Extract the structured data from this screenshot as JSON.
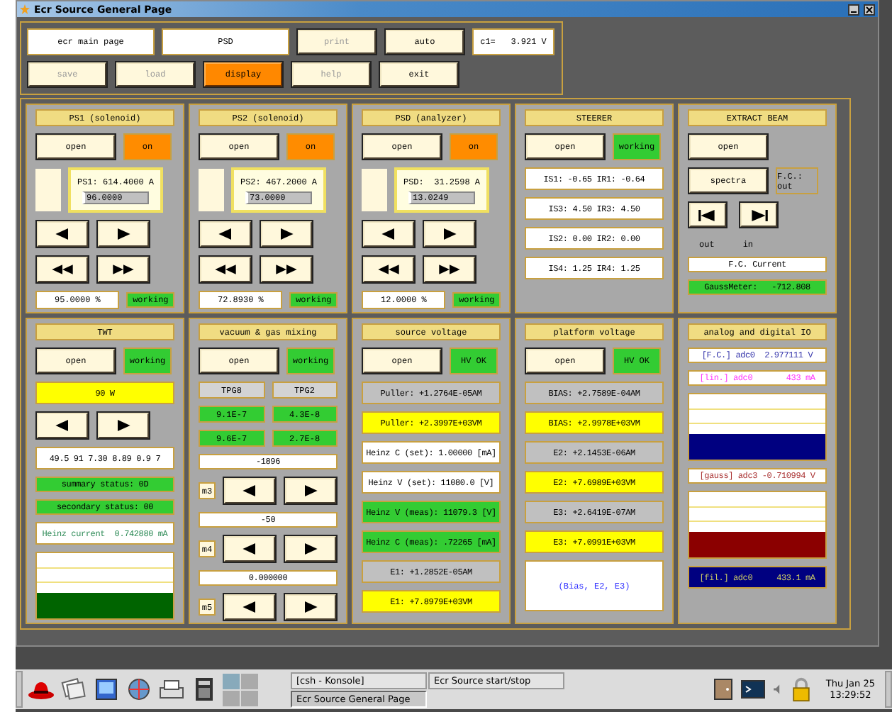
{
  "window": {
    "title": "Ecr Source General Page"
  },
  "toolbar": {
    "row_1": [
      {
        "kind": "label",
        "text": "ecr main page"
      },
      {
        "kind": "label",
        "text": "PSD"
      },
      {
        "kind": "button",
        "text": "print",
        "disabled": true,
        "selected": false
      },
      {
        "kind": "button",
        "text": "auto",
        "disabled": false,
        "selected": false
      },
      {
        "kind": "label",
        "text": "c1=   3.921 V"
      }
    ],
    "row_2": [
      {
        "kind": "button",
        "text": "save",
        "disabled": true,
        "selected": false
      },
      {
        "kind": "button",
        "text": "load",
        "disabled": true,
        "selected": false
      },
      {
        "kind": "button",
        "text": "display",
        "disabled": false,
        "selected": true
      },
      {
        "kind": "button",
        "text": "help",
        "disabled": true,
        "selected": false
      },
      {
        "kind": "button",
        "text": "exit",
        "disabled": false,
        "selected": false
      }
    ]
  },
  "panels": [
    {
      "title": "PS1 (solenoid)",
      "items": [
        {
          "kind": "controls",
          "button": "open",
          "status": {
            "text": "on",
            "color": "#ff8c00"
          }
        },
        {
          "kind": "setpoint",
          "reading": "PS1: 614.4000 A",
          "value": "96.0000"
        },
        {
          "kind": "step"
        },
        {
          "kind": "fast"
        },
        {
          "kind": "footer",
          "reading": "95.0000 %",
          "status": {
            "text": "working",
            "color": "#33cc33"
          }
        }
      ]
    },
    {
      "title": "PS2 (solenoid)",
      "items": [
        {
          "kind": "controls",
          "button": "open",
          "status": {
            "text": "on",
            "color": "#ff8c00"
          }
        },
        {
          "kind": "setpoint",
          "reading": "PS2: 467.2000 A",
          "value": "73.0000"
        },
        {
          "kind": "step"
        },
        {
          "kind": "fast"
        },
        {
          "kind": "footer",
          "reading": "72.8930 %",
          "status": {
            "text": "working",
            "color": "#33cc33"
          }
        }
      ]
    },
    {
      "title": "PSD (analyzer)",
      "items": [
        {
          "kind": "controls",
          "button": "open",
          "status": {
            "text": "on",
            "color": "#ff8c00"
          }
        },
        {
          "kind": "setpoint",
          "reading": "PSD:  31.2598 A",
          "value": "13.0249"
        },
        {
          "kind": "step"
        },
        {
          "kind": "fast"
        },
        {
          "kind": "footer",
          "reading": "12.0000 %",
          "status": {
            "text": "working",
            "color": "#33cc33"
          }
        }
      ]
    },
    {
      "title": "STEERER",
      "items": [
        {
          "kind": "controls",
          "button": "open",
          "status": {
            "text": "working",
            "color": "#33cc33"
          }
        },
        {
          "kind": "readout",
          "text": "IS1: -0.65 IR1: -0.64",
          "color": "#ffffff",
          "tall": true
        },
        {
          "kind": "readout",
          "text": "IS3: 4.50 IR3: 4.50",
          "color": "#ffffff",
          "tall": true
        },
        {
          "kind": "readout",
          "text": "IS2: 0.00 IR2: 0.00",
          "color": "#ffffff",
          "tall": true
        },
        {
          "kind": "readout",
          "text": "IS4: 1.25 IR4: 1.25",
          "color": "#ffffff",
          "tall": true
        }
      ]
    },
    {
      "title": "EXTRACT BEAM",
      "items": [
        {
          "kind": "controls",
          "button": "open"
        },
        {
          "kind": "action",
          "button": "spectra",
          "reading": "F.C.: out"
        },
        {
          "kind": "jump",
          "labels": [
            "out",
            "in"
          ]
        },
        {
          "kind": "readout",
          "text": "F.C. Current",
          "color": "#ffffff"
        },
        {
          "kind": "readout",
          "text": "GaussMeter:   -712.808",
          "color": "#33cc33"
        }
      ]
    },
    {
      "title": "TWT",
      "items": [
        {
          "kind": "controls",
          "button": "open",
          "status": {
            "text": "working",
            "color": "#33cc33"
          }
        },
        {
          "kind": "readout",
          "text": "90 W",
          "color": "#ffff00",
          "tall": true
        },
        {
          "kind": "step"
        },
        {
          "kind": "readout",
          "text": "49.5 91 7.30 8.89 0.9 7",
          "color": "#ffffff",
          "tall": true
        },
        {
          "kind": "readout",
          "text": "summary status: 0D",
          "color": "#33cc33"
        },
        {
          "kind": "readout",
          "text": "secondary status: 00",
          "color": "#33cc33"
        },
        {
          "kind": "signal",
          "text": "Heinz current  0.742880 mA",
          "color": "#2e8b57",
          "tall": true
        },
        {
          "kind": "trend",
          "color": "#006400"
        }
      ]
    },
    {
      "title": "vacuum & gas mixing",
      "items": [
        {
          "kind": "controls",
          "button": "open",
          "status": {
            "text": "working",
            "color": "#33cc33"
          }
        },
        {
          "kind": "pair",
          "cells": [
            {
              "text": "TPG8",
              "color": "#d3d3d3"
            },
            {
              "text": "TPG2",
              "color": "#d3d3d3"
            }
          ]
        },
        {
          "kind": "pair",
          "cells": [
            {
              "text": "9.1E-7",
              "color": "#33cc33"
            },
            {
              "text": "4.3E-8",
              "color": "#33cc33"
            }
          ]
        },
        {
          "kind": "pair",
          "cells": [
            {
              "text": "9.6E-7",
              "color": "#33cc33"
            },
            {
              "text": "2.7E-8",
              "color": "#33cc33"
            }
          ]
        },
        {
          "kind": "readout",
          "text": "-1896",
          "color": "#ffffff"
        },
        {
          "kind": "step",
          "label": "m3"
        },
        {
          "kind": "readout",
          "text": "-50",
          "color": "#ffffff"
        },
        {
          "kind": "step",
          "label": "m4"
        },
        {
          "kind": "readout",
          "text": "0.000000",
          "color": "#ffffff"
        },
        {
          "kind": "step",
          "label": "m5"
        }
      ]
    },
    {
      "title": "source voltage",
      "items": [
        {
          "kind": "controls",
          "button": "open",
          "status": {
            "text": "HV OK",
            "color": "#33cc33"
          }
        },
        {
          "kind": "readout",
          "text": "Puller: +1.2764E-05AM",
          "color": "#c0c0c0",
          "tall": true
        },
        {
          "kind": "readout",
          "text": "Puller: +2.3997E+03VM",
          "color": "#ffff00",
          "tall": true
        },
        {
          "kind": "readout",
          "text": "Heinz C (set): 1.00000 [mA]",
          "color": "#ffffff",
          "tall": true
        },
        {
          "kind": "readout",
          "text": "Heinz V (set): 11080.0 [V]",
          "color": "#ffffff",
          "tall": true
        },
        {
          "kind": "readout",
          "text": "Heinz V (meas): 11079.3 [V]",
          "color": "#33cc33",
          "tall": true
        },
        {
          "kind": "readout",
          "text": "Heinz C (meas): .72265 [mA]",
          "color": "#33cc33",
          "tall": true
        },
        {
          "kind": "readout",
          "text": "E1: +1.2852E-05AM",
          "color": "#c0c0c0",
          "tall": true
        },
        {
          "kind": "readout",
          "text": "E1: +7.8979E+03VM",
          "color": "#ffff00",
          "tall": true
        }
      ]
    },
    {
      "title": "platform voltage",
      "items": [
        {
          "kind": "controls",
          "button": "open",
          "status": {
            "text": "HV OK",
            "color": "#33cc33"
          }
        },
        {
          "kind": "readout",
          "text": "BIAS: +2.7589E-04AM",
          "color": "#c0c0c0",
          "tall": true
        },
        {
          "kind": "readout",
          "text": "BIAS: +2.9978E+03VM",
          "color": "#ffff00",
          "tall": true
        },
        {
          "kind": "readout",
          "text": "E2: +2.1453E-06AM",
          "color": "#c0c0c0",
          "tall": true
        },
        {
          "kind": "readout",
          "text": "E2: +7.6989E+03VM",
          "color": "#ffff00",
          "tall": true
        },
        {
          "kind": "readout",
          "text": "E3: +2.6419E-07AM",
          "color": "#c0c0c0",
          "tall": true
        },
        {
          "kind": "readout",
          "text": "E3: +7.0991E+03VM",
          "color": "#ffff00",
          "tall": true
        },
        {
          "kind": "note",
          "text": "(Bias, E2, E3)"
        }
      ]
    },
    {
      "title": "analog and digital IO",
      "items": [
        {
          "kind": "signal",
          "text": "[F.C.] adc0  2.977111 V",
          "color": "#3333aa"
        },
        {
          "kind": "signal",
          "text": "[lin.] adc0       433 mA",
          "color": "#ff33ff"
        },
        {
          "kind": "trend",
          "color": "#000080"
        },
        {
          "kind": "signal",
          "text": "[gauss] adc3 -0.710994 V",
          "color": "#aa3333"
        },
        {
          "kind": "trend",
          "color": "#8b0000"
        },
        {
          "kind": "readout",
          "text": "[fil.] adc0     433.1 mA",
          "color": "#000080",
          "tall": true
        }
      ]
    }
  ],
  "taskbar": {
    "tasks": [
      {
        "label": "[csh - Konsole]",
        "selected": false
      },
      {
        "label": "Ecr Source General Page",
        "selected": true
      },
      {
        "label": "Ecr Source start/stop",
        "selected": false
      }
    ],
    "clock": {
      "date": "Thu Jan 25",
      "time": "13:29:52"
    }
  }
}
